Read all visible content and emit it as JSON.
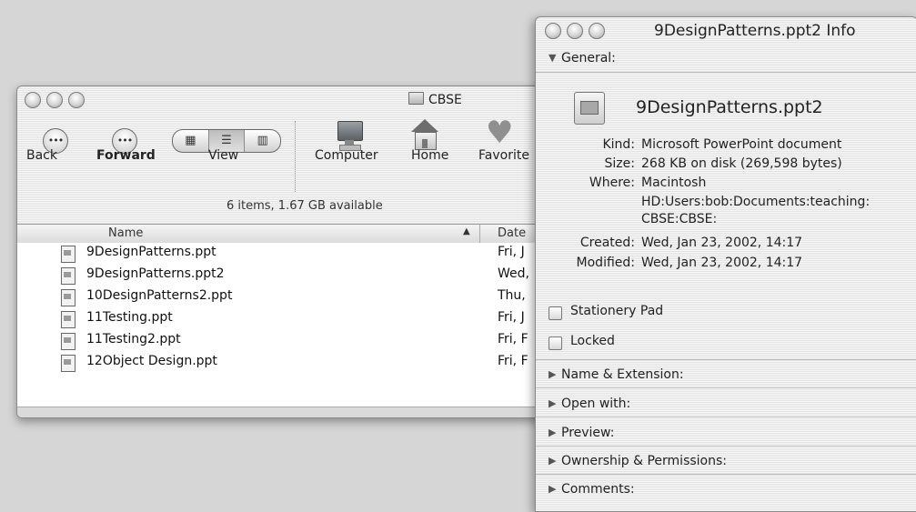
{
  "finder": {
    "title": "CBSE",
    "toolbar": {
      "back": "Back",
      "forward": "Forward",
      "view": "View",
      "computer": "Computer",
      "home": "Home",
      "favorites": "Favorite"
    },
    "status": "6 items, 1.67 GB available",
    "columns": {
      "name": "Name",
      "date": "Date"
    },
    "files": [
      {
        "name": "9DesignPatterns.ppt",
        "date": "Fri, J"
      },
      {
        "name": "9DesignPatterns.ppt2",
        "date": "Wed,"
      },
      {
        "name": "10DesignPatterns2.ppt",
        "date": "Thu,"
      },
      {
        "name": "11Testing.ppt",
        "date": "Fri, J"
      },
      {
        "name": "11Testing2.ppt",
        "date": "Fri, F"
      },
      {
        "name": "12Object Design.ppt",
        "date": "Fri, F"
      }
    ]
  },
  "info": {
    "title": "9DesignPatterns.ppt2 Info",
    "general_label": "General:",
    "filename": "9DesignPatterns.ppt2",
    "kind_key": "Kind:",
    "kind": "Microsoft PowerPoint document",
    "size_key": "Size:",
    "size": "268 KB on disk (269,598 bytes)",
    "where_key": "Where:",
    "where_1": "Macintosh",
    "where_2": "HD:Users:bob:Documents:teaching:",
    "where_3": "CBSE:CBSE:",
    "created_key": "Created:",
    "created": "Wed, Jan 23, 2002, 14:17",
    "modified_key": "Modified:",
    "modified": "Wed, Jan 23, 2002, 14:17",
    "stationery": "Stationery Pad",
    "locked": "Locked",
    "sections": [
      "Name & Extension:",
      "Open with:",
      "Preview:",
      "Ownership & Permissions:",
      "Comments:"
    ]
  }
}
